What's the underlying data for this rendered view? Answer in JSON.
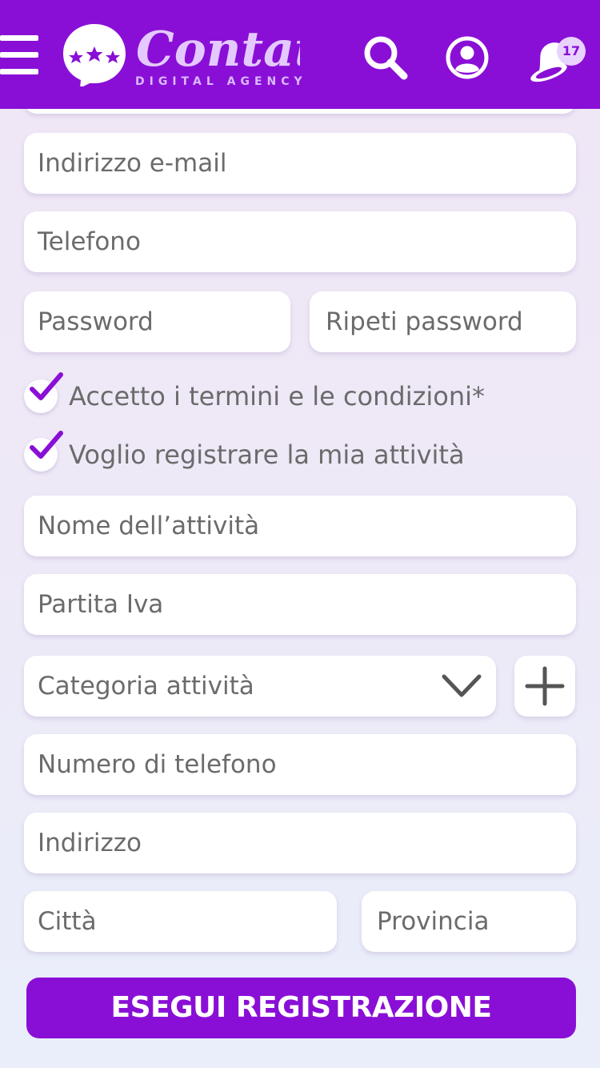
{
  "header": {
    "logo_word": "Contat",
    "logo_subtitle": "DIGITAL AGENCY",
    "notification_count": "17",
    "icons": [
      "menu-icon",
      "logo-bubble-icon",
      "search-icon",
      "user-icon",
      "bell-icon"
    ]
  },
  "form": {
    "email_placeholder": "Indirizzo e-mail",
    "phone_placeholder": "Telefono",
    "password_placeholder": "Password",
    "repeat_password_placeholder": "Ripeti password",
    "terms_label": "Accetto i termini e le condizioni*",
    "terms_checked": true,
    "register_business_label": "Voglio registrare la mia attività",
    "register_business_checked": true,
    "business_name_placeholder": "Nome dell’attività",
    "vat_placeholder": "Partita Iva",
    "category_placeholder": "Categoria attività",
    "business_phone_placeholder": "Numero di telefono",
    "address_placeholder": "Indirizzo",
    "city_placeholder": "Città",
    "province_placeholder": "Provincia",
    "submit_label": "ESEGUI REGISTRAZIONE"
  },
  "colors": {
    "brand": "#8a0fd6",
    "field_text": "#6b6b6b",
    "background": "#eee9f7"
  }
}
